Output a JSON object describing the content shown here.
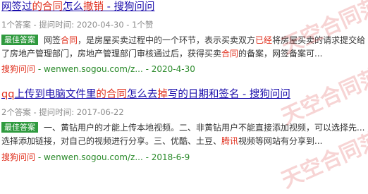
{
  "results": [
    {
      "title": [
        {
          "text": "网签过",
          "hl": false
        },
        {
          "text": "的合同",
          "hl": true
        },
        {
          "text": "怎么",
          "hl": false
        },
        {
          "text": "撤销",
          "hl": true
        },
        {
          "text": " - 搜狗问问",
          "hl": false
        }
      ],
      "meta": "1个答案 - 提问时间: 2020-04-30 - 1个赞",
      "badge": "最佳答案",
      "snippet": [
        {
          "text": "网签",
          "hl": false
        },
        {
          "text": "合同",
          "hl": true
        },
        {
          "text": "，是房屋买卖过程中的一个环节，表示买卖双方",
          "hl": false
        },
        {
          "text": "已经",
          "hl": true
        },
        {
          "text": "将房屋买卖的请求提交给了房地产管理部门，房地产管理部门审核通过后，获得买卖",
          "hl": false
        },
        {
          "text": "合同",
          "hl": true
        },
        {
          "text": "的备案，网签备案可...",
          "hl": false
        }
      ],
      "source": [
        {
          "text": "搜狗问问",
          "hl": true
        },
        {
          "text": " - wenwen.sogou.com/z... - 2020-4-30",
          "hl": false
        }
      ]
    },
    {
      "title": [
        {
          "text": "qq",
          "hl": true
        },
        {
          "text": "上传到电脑文件里",
          "hl": false
        },
        {
          "text": "的合同",
          "hl": true
        },
        {
          "text": "怎么去",
          "hl": false
        },
        {
          "text": "掉",
          "hl": true
        },
        {
          "text": "写的日期和签名 - 搜狗问问",
          "hl": false
        }
      ],
      "meta": "2个答案 - 提问时间: 2017-06-22",
      "badge": "最佳答案",
      "snippet": [
        {
          "text": "一、黄钻用户的才能上传本地视频。二、非黄钻用户不能直接添加视频，可以选择先... 选择添加链接，对自己的视频进行分享。三、优酷、土豆、",
          "hl": false
        },
        {
          "text": "腾讯",
          "hl": true
        },
        {
          "text": "视频等网站有分享到...",
          "hl": false
        }
      ],
      "source": [
        {
          "text": "搜狗问问",
          "hl": true
        },
        {
          "text": " - wenwen.sogou.com/z... - 2018-6-9",
          "hl": false
        }
      ]
    }
  ],
  "watermark": "天空合同范文"
}
